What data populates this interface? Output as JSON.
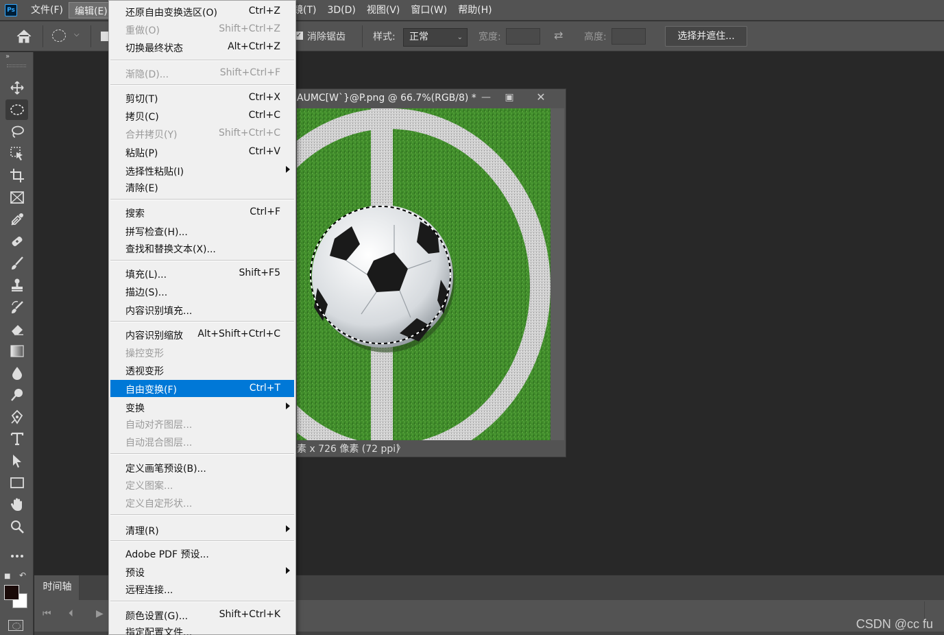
{
  "app": {
    "logo_text": "Ps"
  },
  "menubar": {
    "file": "文件(F)",
    "edit": "编辑(E)",
    "filter_partial": "镜(T)",
    "threed": "3D(D)",
    "view": "视图(V)",
    "window": "窗口(W)",
    "help": "帮助(H)"
  },
  "options": {
    "antialias_label": "消除锯齿",
    "style_label": "样式:",
    "style_value": "正常",
    "width_label": "宽度:",
    "height_label": "高度:",
    "select_mask_button": "选择并遮住..."
  },
  "document": {
    "title": "AUMC[W`}@P.png @ 66.7%(RGB/8) *",
    "status": "素 x 726 像素 (72 ppi)"
  },
  "timeline": {
    "tab_label": "时间轴"
  },
  "watermark": "CSDN @cc fu",
  "edit_menu": {
    "items": [
      {
        "label": "还原自由变换选区(O)",
        "shortcut": "Ctrl+Z"
      },
      {
        "label": "重做(O)",
        "shortcut": "Shift+Ctrl+Z"
      },
      {
        "label": "切换最终状态",
        "shortcut": "Alt+Ctrl+Z"
      },
      {
        "label": "渐隐(D)...",
        "shortcut": "Shift+Ctrl+F"
      },
      {
        "label": "剪切(T)",
        "shortcut": "Ctrl+X"
      },
      {
        "label": "拷贝(C)",
        "shortcut": "Ctrl+C"
      },
      {
        "label": "合并拷贝(Y)",
        "shortcut": "Shift+Ctrl+C"
      },
      {
        "label": "粘贴(P)",
        "shortcut": "Ctrl+V"
      },
      {
        "label": "选择性粘贴(I)",
        "shortcut": ""
      },
      {
        "label": "清除(E)",
        "shortcut": ""
      },
      {
        "label": "搜索",
        "shortcut": "Ctrl+F"
      },
      {
        "label": "拼写检查(H)...",
        "shortcut": ""
      },
      {
        "label": "查找和替换文本(X)...",
        "shortcut": ""
      },
      {
        "label": "填充(L)...",
        "shortcut": "Shift+F5"
      },
      {
        "label": "描边(S)...",
        "shortcut": ""
      },
      {
        "label": "内容识别填充...",
        "shortcut": ""
      },
      {
        "label": "内容识别缩放",
        "shortcut": "Alt+Shift+Ctrl+C"
      },
      {
        "label": "操控变形",
        "shortcut": ""
      },
      {
        "label": "透视变形",
        "shortcut": ""
      },
      {
        "label": "自由变换(F)",
        "shortcut": "Ctrl+T"
      },
      {
        "label": "变换",
        "shortcut": ""
      },
      {
        "label": "自动对齐图层...",
        "shortcut": ""
      },
      {
        "label": "自动混合图层...",
        "shortcut": ""
      },
      {
        "label": "定义画笔预设(B)...",
        "shortcut": ""
      },
      {
        "label": "定义图案...",
        "shortcut": ""
      },
      {
        "label": "定义自定形状...",
        "shortcut": ""
      },
      {
        "label": "清理(R)",
        "shortcut": ""
      },
      {
        "label": "Adobe PDF 预设...",
        "shortcut": ""
      },
      {
        "label": "预设",
        "shortcut": ""
      },
      {
        "label": "远程连接...",
        "shortcut": ""
      },
      {
        "label": "颜色设置(G)...",
        "shortcut": "Shift+Ctrl+K"
      },
      {
        "label": "指定配置文件...",
        "shortcut": ""
      }
    ]
  }
}
